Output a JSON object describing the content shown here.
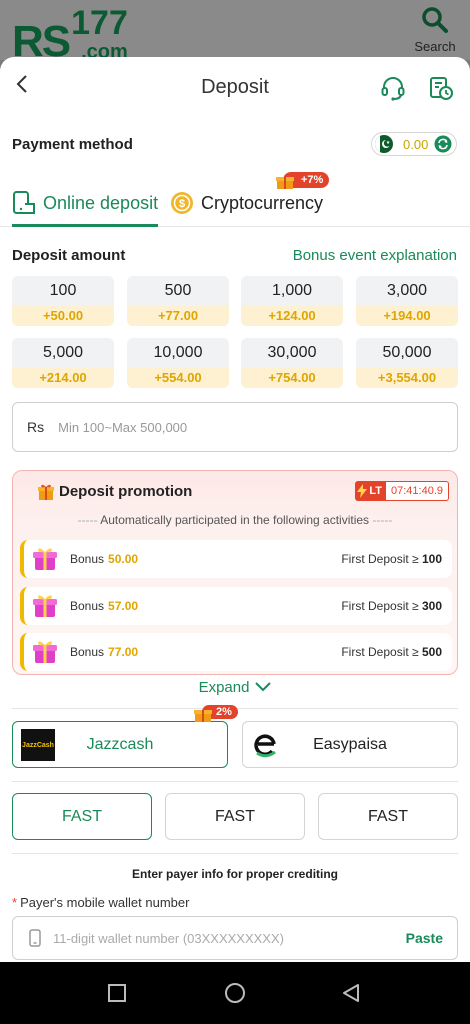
{
  "brand": {
    "logo_text": "RS",
    "logo_num": "177",
    "logo_domain": ".com"
  },
  "top_search": {
    "label": "Search"
  },
  "header": {
    "title": "Deposit"
  },
  "payment_method": {
    "label": "Payment method",
    "balance": "0.00"
  },
  "tabs": [
    {
      "label": "Online deposit",
      "active": true
    },
    {
      "label": "Cryptocurrency",
      "active": false,
      "badge": "+7%"
    }
  ],
  "deposit_amount": {
    "label": "Deposit amount",
    "bonus_link": "Bonus event explanation"
  },
  "amounts": [
    {
      "value": "100",
      "bonus": "+50.00"
    },
    {
      "value": "500",
      "bonus": "+77.00"
    },
    {
      "value": "1,000",
      "bonus": "+124.00"
    },
    {
      "value": "3,000",
      "bonus": "+194.00"
    },
    {
      "value": "5,000",
      "bonus": "+214.00"
    },
    {
      "value": "10,000",
      "bonus": "+554.00"
    },
    {
      "value": "30,000",
      "bonus": "+754.00"
    },
    {
      "value": "50,000",
      "bonus": "+3,554.00"
    }
  ],
  "amount_input": {
    "currency": "Rs",
    "placeholder": "Min 100~Max 500,000"
  },
  "promotion": {
    "title": "Deposit promotion",
    "lt": "LT",
    "timer": "07:41:40.9",
    "subtitle": "Automatically participated in the following activities",
    "rows": [
      {
        "label": "Bonus",
        "value": "50.00",
        "condition": "First Deposit ≥",
        "threshold": "100"
      },
      {
        "label": "Bonus",
        "value": "57.00",
        "condition": "First Deposit ≥",
        "threshold": "300"
      },
      {
        "label": "Bonus",
        "value": "77.00",
        "condition": "First Deposit ≥",
        "threshold": "500"
      }
    ]
  },
  "expand": {
    "label": "Expand"
  },
  "channels": [
    {
      "label": "Jazzcash",
      "badge": "2%",
      "logo_text": "JazzCash",
      "selected": true
    },
    {
      "label": "Easypaisa",
      "selected": false
    }
  ],
  "speeds": [
    {
      "label": "FAST",
      "selected": true
    },
    {
      "label": "FAST",
      "selected": false
    },
    {
      "label": "FAST",
      "selected": false
    }
  ],
  "payer": {
    "note": "Enter payer info for proper crediting",
    "field_label": "Payer's mobile wallet number",
    "required_mark": "*",
    "placeholder": "11-digit wallet number (03XXXXXXXXX)",
    "paste": "Paste"
  },
  "colors": {
    "accent": "#1a8a5a",
    "bonus": "#e0a500",
    "promo_red": "#e2432a"
  }
}
